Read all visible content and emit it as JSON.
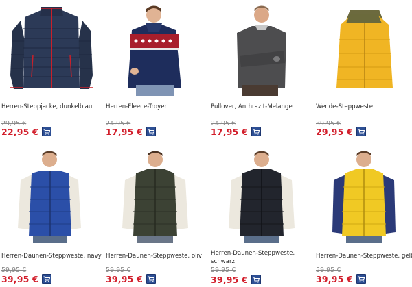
{
  "products": [
    {
      "name": "Herren-Steppjacke, dunkelblau",
      "old_price": "29,95 €",
      "price": "22,95 €",
      "icon": "cart-icon"
    },
    {
      "name": "Herren-Fleece-Troyer",
      "old_price": "24,95 €",
      "price": "17,95 €",
      "icon": "cart-icon"
    },
    {
      "name": "Pullover, Anthrazit-Melange",
      "old_price": "24,95 €",
      "price": "17,95 €",
      "icon": "cart-icon"
    },
    {
      "name": "Wende-Steppweste",
      "old_price": "39,95 €",
      "price": "29,95 €",
      "icon": "cart-icon"
    },
    {
      "name": "Herren-Daunen-Steppweste, navy",
      "old_price": "59,95 €",
      "price": "39,95 €",
      "icon": "cart-icon"
    },
    {
      "name": "Herren-Daunen-Steppweste, oliv",
      "old_price": "59,95 €",
      "price": "39,95 €",
      "icon": "cart-icon"
    },
    {
      "name": "Herren-Daunen-Steppweste, schwarz",
      "old_price": "59,95 €",
      "price": "39,95 €",
      "icon": "cart-icon"
    },
    {
      "name": "Herren-Daunen-Steppweste, gelb",
      "old_price": "59,95 €",
      "price": "39,95 €",
      "icon": "cart-icon"
    }
  ],
  "colors": {
    "price_red": "#d21e2b",
    "old_price_gray": "#8a8a8a",
    "cart_blue": "#2d4f94"
  }
}
